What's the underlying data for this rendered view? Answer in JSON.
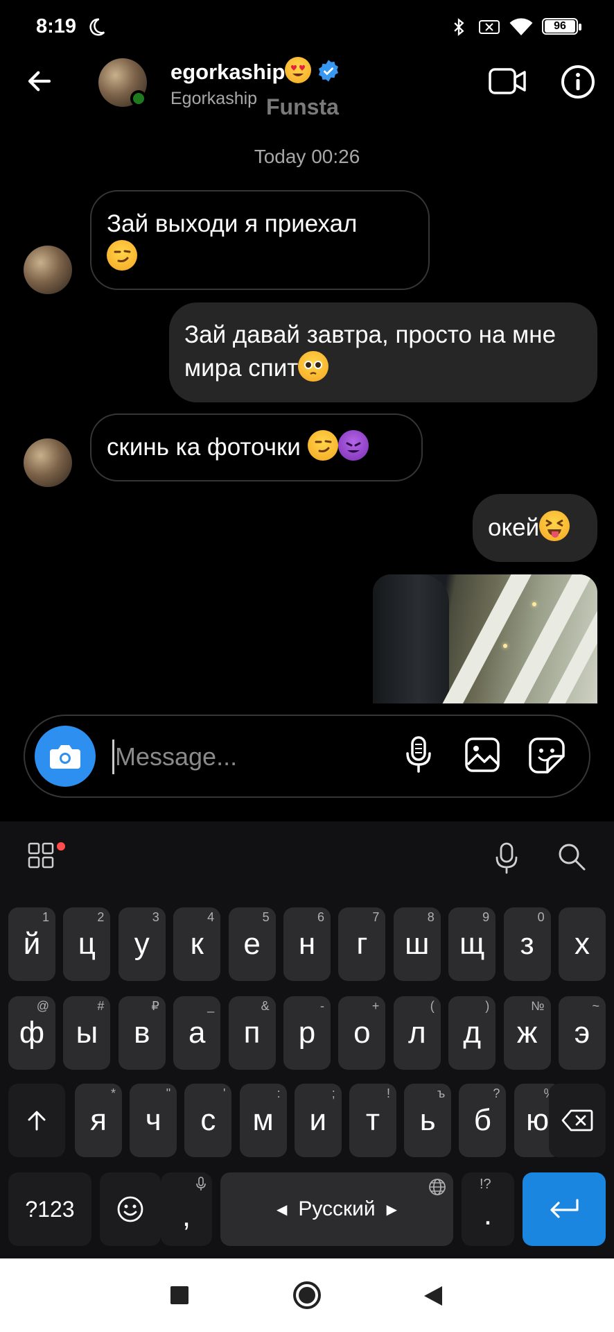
{
  "status_bar": {
    "time": "8:19",
    "battery": "96",
    "icons": [
      "moon-icon",
      "bluetooth-icon",
      "sim-off-icon",
      "wifi-icon",
      "battery-icon"
    ]
  },
  "header": {
    "contact_name": "egorkaship",
    "name_emoji": "heart-eyes-emoji",
    "verified": true,
    "username": "Egorkaship",
    "watermark": "Funsta",
    "icons": [
      "back-arrow-icon",
      "video-call-icon",
      "info-icon"
    ]
  },
  "chat": {
    "date_label": "Today 00:26",
    "messages": [
      {
        "direction": "incoming",
        "text": "Зай выходи я приехал",
        "emoji": "smirk-emoji"
      },
      {
        "direction": "outgoing",
        "text": "Зай давай завтра, просто на мне мира спит",
        "emoji": "pleading-emoji"
      },
      {
        "direction": "incoming",
        "text": "скинь ка фоточки",
        "emoji": "smirk-emoji devil-emoji"
      },
      {
        "direction": "outgoing",
        "text": "окей",
        "emoji": "tongue-emoji"
      },
      {
        "direction": "outgoing",
        "type": "photo"
      }
    ]
  },
  "composer": {
    "placeholder": "Message...",
    "icons": [
      "camera-icon",
      "microphone-icon",
      "gallery-icon",
      "sticker-icon"
    ]
  },
  "keyboard": {
    "row1": [
      {
        "key": "й",
        "hint": "1"
      },
      {
        "key": "ц",
        "hint": "2"
      },
      {
        "key": "у",
        "hint": "3"
      },
      {
        "key": "к",
        "hint": "4"
      },
      {
        "key": "е",
        "hint": "5"
      },
      {
        "key": "н",
        "hint": "6"
      },
      {
        "key": "г",
        "hint": "7"
      },
      {
        "key": "ш",
        "hint": "8"
      },
      {
        "key": "щ",
        "hint": "9"
      },
      {
        "key": "з",
        "hint": "0"
      },
      {
        "key": "х",
        "hint": ""
      }
    ],
    "row2": [
      {
        "key": "ф",
        "hint": "@"
      },
      {
        "key": "ы",
        "hint": "#"
      },
      {
        "key": "в",
        "hint": "₽"
      },
      {
        "key": "а",
        "hint": "_"
      },
      {
        "key": "п",
        "hint": "&"
      },
      {
        "key": "р",
        "hint": "-"
      },
      {
        "key": "о",
        "hint": "+"
      },
      {
        "key": "л",
        "hint": "("
      },
      {
        "key": "д",
        "hint": ")"
      },
      {
        "key": "ж",
        "hint": "№"
      },
      {
        "key": "э",
        "hint": "~"
      }
    ],
    "row3": [
      {
        "key": "я",
        "hint": "*"
      },
      {
        "key": "ч",
        "hint": "\""
      },
      {
        "key": "с",
        "hint": "'"
      },
      {
        "key": "м",
        "hint": ":"
      },
      {
        "key": "и",
        "hint": ";"
      },
      {
        "key": "т",
        "hint": "!"
      },
      {
        "key": "ь",
        "hint": "ъ"
      },
      {
        "key": "б",
        "hint": "?"
      },
      {
        "key": "ю",
        "hint": "%"
      }
    ],
    "symbols_key": "?123",
    "comma_key": ",",
    "space_label": "Русский",
    "period_key": ".",
    "period_hint": "!?",
    "top_icons": [
      "apps-grid-icon",
      "microphone-icon",
      "search-icon"
    ]
  },
  "nav_bar": {
    "icons": [
      "recents-icon",
      "home-icon",
      "back-icon"
    ]
  }
}
